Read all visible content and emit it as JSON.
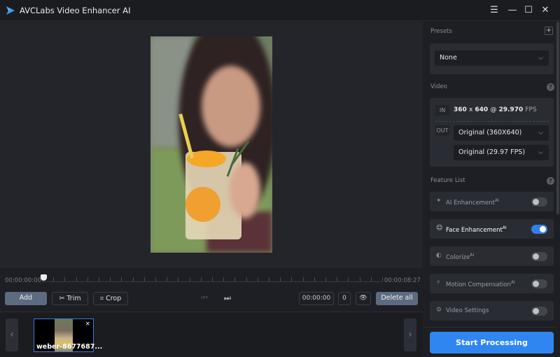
{
  "titlebar": {
    "title": "AVCLabs Video Enhancer AI",
    "menu_icon": "☰",
    "min_icon": "—",
    "max_icon": "☐",
    "close_icon": "✕"
  },
  "timeline": {
    "start": "00:00:00:00",
    "end": "00:00:08:27"
  },
  "toolbar": {
    "add": "Add",
    "trim": "Trim",
    "crop": "Crop",
    "time_field": "00:00:00",
    "frame_field": "0",
    "delete_all": "Delete all"
  },
  "strip": {
    "thumb_name": "weber-8677687...",
    "prev": "‹",
    "next": "›",
    "close": "×"
  },
  "side": {
    "presets_label": "Presets",
    "preset_value": "None",
    "video_label": "Video",
    "in_label": "IN",
    "in_res": "360",
    "in_x": "x",
    "in_res2": "640",
    "in_at": "@",
    "in_fps": "29.970",
    "in_fps_unit": "FPS",
    "out_label": "OUT",
    "out_res": "Original (360X640)",
    "out_fps": "Original (29.97 FPS)",
    "feature_label": "Feature List",
    "features": [
      {
        "label": "AI Enhancement",
        "sup": "AI",
        "on": false
      },
      {
        "label": "Face Enhancement",
        "sup": "AI",
        "on": true
      },
      {
        "label": "Colorize",
        "sup": "AI",
        "on": false
      },
      {
        "label": "Motion Compensation",
        "sup": "AI",
        "on": false
      },
      {
        "label": "Video Settings",
        "sup": "",
        "on": false
      }
    ],
    "start": "Start Processing"
  },
  "colors": {
    "accent": "#2f86f0",
    "toggle_on": "#2f80ed",
    "button_fill": "#5c6b80"
  }
}
